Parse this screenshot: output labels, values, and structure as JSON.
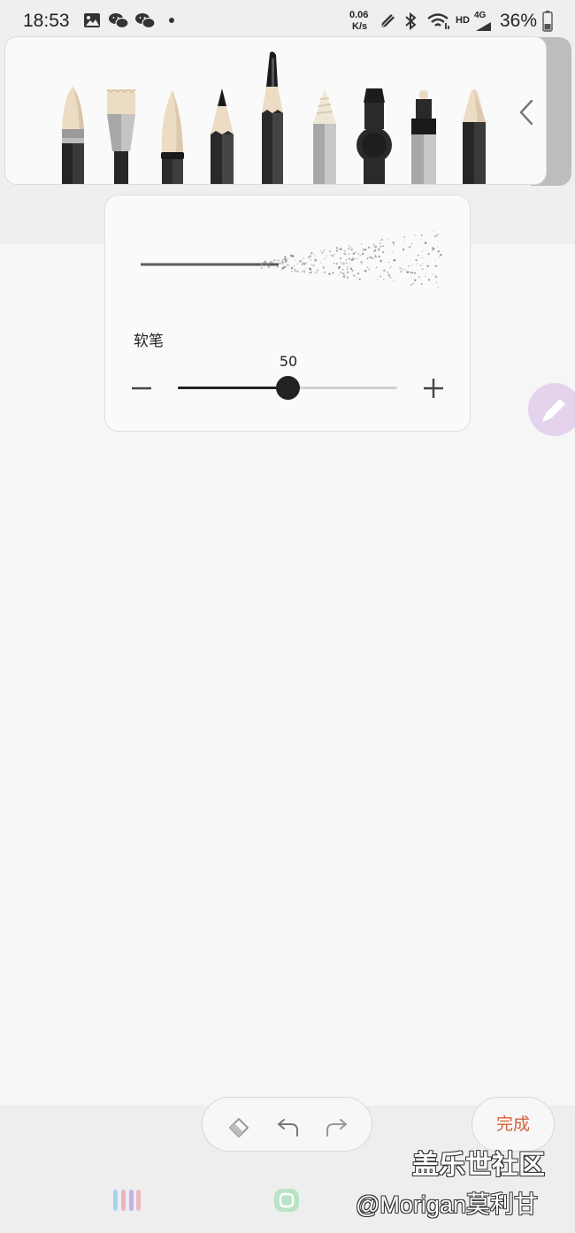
{
  "status_bar": {
    "time": "18:53",
    "network_speed_value": "0.06",
    "network_speed_unit": "K/s",
    "hd_label": "HD",
    "lte_label": "4G",
    "battery": "36%",
    "icons": [
      "gallery-icon",
      "wechat-icon",
      "wechat-icon",
      "dot-icon",
      "pen-icon",
      "bluetooth-icon",
      "wifi-icon",
      "battery-icon"
    ]
  },
  "pen_toolbar": {
    "pens": [
      "brush-pen",
      "flat-brush",
      "ink-brush",
      "pencil",
      "fountain-pen",
      "colored-pencil",
      "marker",
      "paint-marker",
      "crayon"
    ],
    "selected_pen": "fountain-pen",
    "collapse_icon": "chevron-left-icon"
  },
  "pen_settings": {
    "pen_name": "软笔",
    "size_value": "50",
    "size_level": 0.5
  },
  "bottom": {
    "done_label": "完成"
  },
  "watermark": {
    "line1": "盖乐世社区",
    "line2": "@Morigan莫利甘"
  },
  "colors": {
    "accent_done": "#d4603a",
    "fab": "#e5d3ee",
    "background": "#f2f2f2"
  }
}
